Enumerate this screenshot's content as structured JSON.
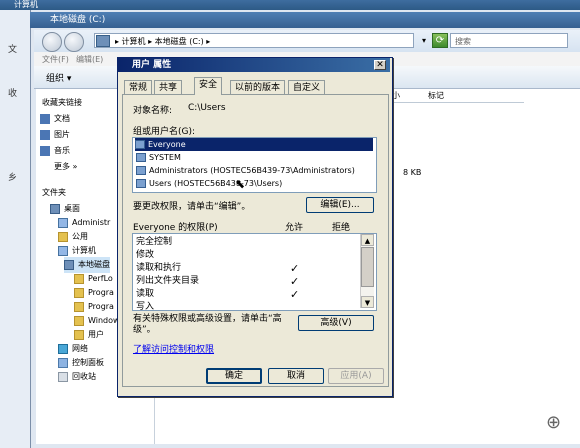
{
  "window": {
    "outer_title": "计算机",
    "inner_title": "本地磁盘 (C:)",
    "address": "▸ 计算机 ▸ 本地磁盘 (C:) ▸",
    "search_placeholder": "搜索",
    "menu": [
      "文件(F)",
      "编辑(E)"
    ],
    "toolbar_organize": "组织 ▾"
  },
  "left_strip": [
    "文",
    "收",
    "乡"
  ],
  "nav": {
    "favorites_header": "收藏夹链接",
    "favorites": [
      "文档",
      "图片",
      "音乐",
      "更多 »"
    ],
    "folders_header": "文件夹",
    "tree": [
      "桌面",
      "Administr",
      "公用",
      "计算机",
      "本地磁盘",
      "PerfLo",
      "Progra",
      "Progra",
      "Window",
      "用户",
      "网络",
      "控制面板",
      "回收站"
    ]
  },
  "file_area": {
    "columns": [
      "小",
      "标记"
    ],
    "size_value": "8 KB"
  },
  "dialog": {
    "title": "用户 属性",
    "tabs": [
      "常规",
      "共享",
      "安全",
      "以前的版本",
      "自定义"
    ],
    "object_label": "对象名称:",
    "object_value": "C:\\Users",
    "group_label": "组或用户名(G):",
    "principals": [
      "Everyone",
      "SYSTEM",
      "Administrators (HOSTEC56B439-73\\Administrators)",
      "Users (HOSTEC56B439-73\\Users)"
    ],
    "change_text": "要更改权限，请单击“编辑”。",
    "edit_button": "编辑(E)...",
    "perm_header": "Everyone 的权限(P)",
    "allow_header": "允许",
    "deny_header": "拒绝",
    "permissions": [
      {
        "name": "完全控制",
        "allow": ""
      },
      {
        "name": "修改",
        "allow": ""
      },
      {
        "name": "读取和执行",
        "allow": "✓"
      },
      {
        "name": "列出文件夹目录",
        "allow": "✓"
      },
      {
        "name": "读取",
        "allow": "✓"
      },
      {
        "name": "写入",
        "allow": ""
      }
    ],
    "advanced_text_1": "有关特殊权限或高级设置，请单击“高",
    "advanced_text_2": "级”。",
    "advanced_button": "高级(V)",
    "help_link": "了解访问控制和权限",
    "ok_button": "确定",
    "cancel_button": "取消",
    "apply_button": "应用(A)"
  }
}
